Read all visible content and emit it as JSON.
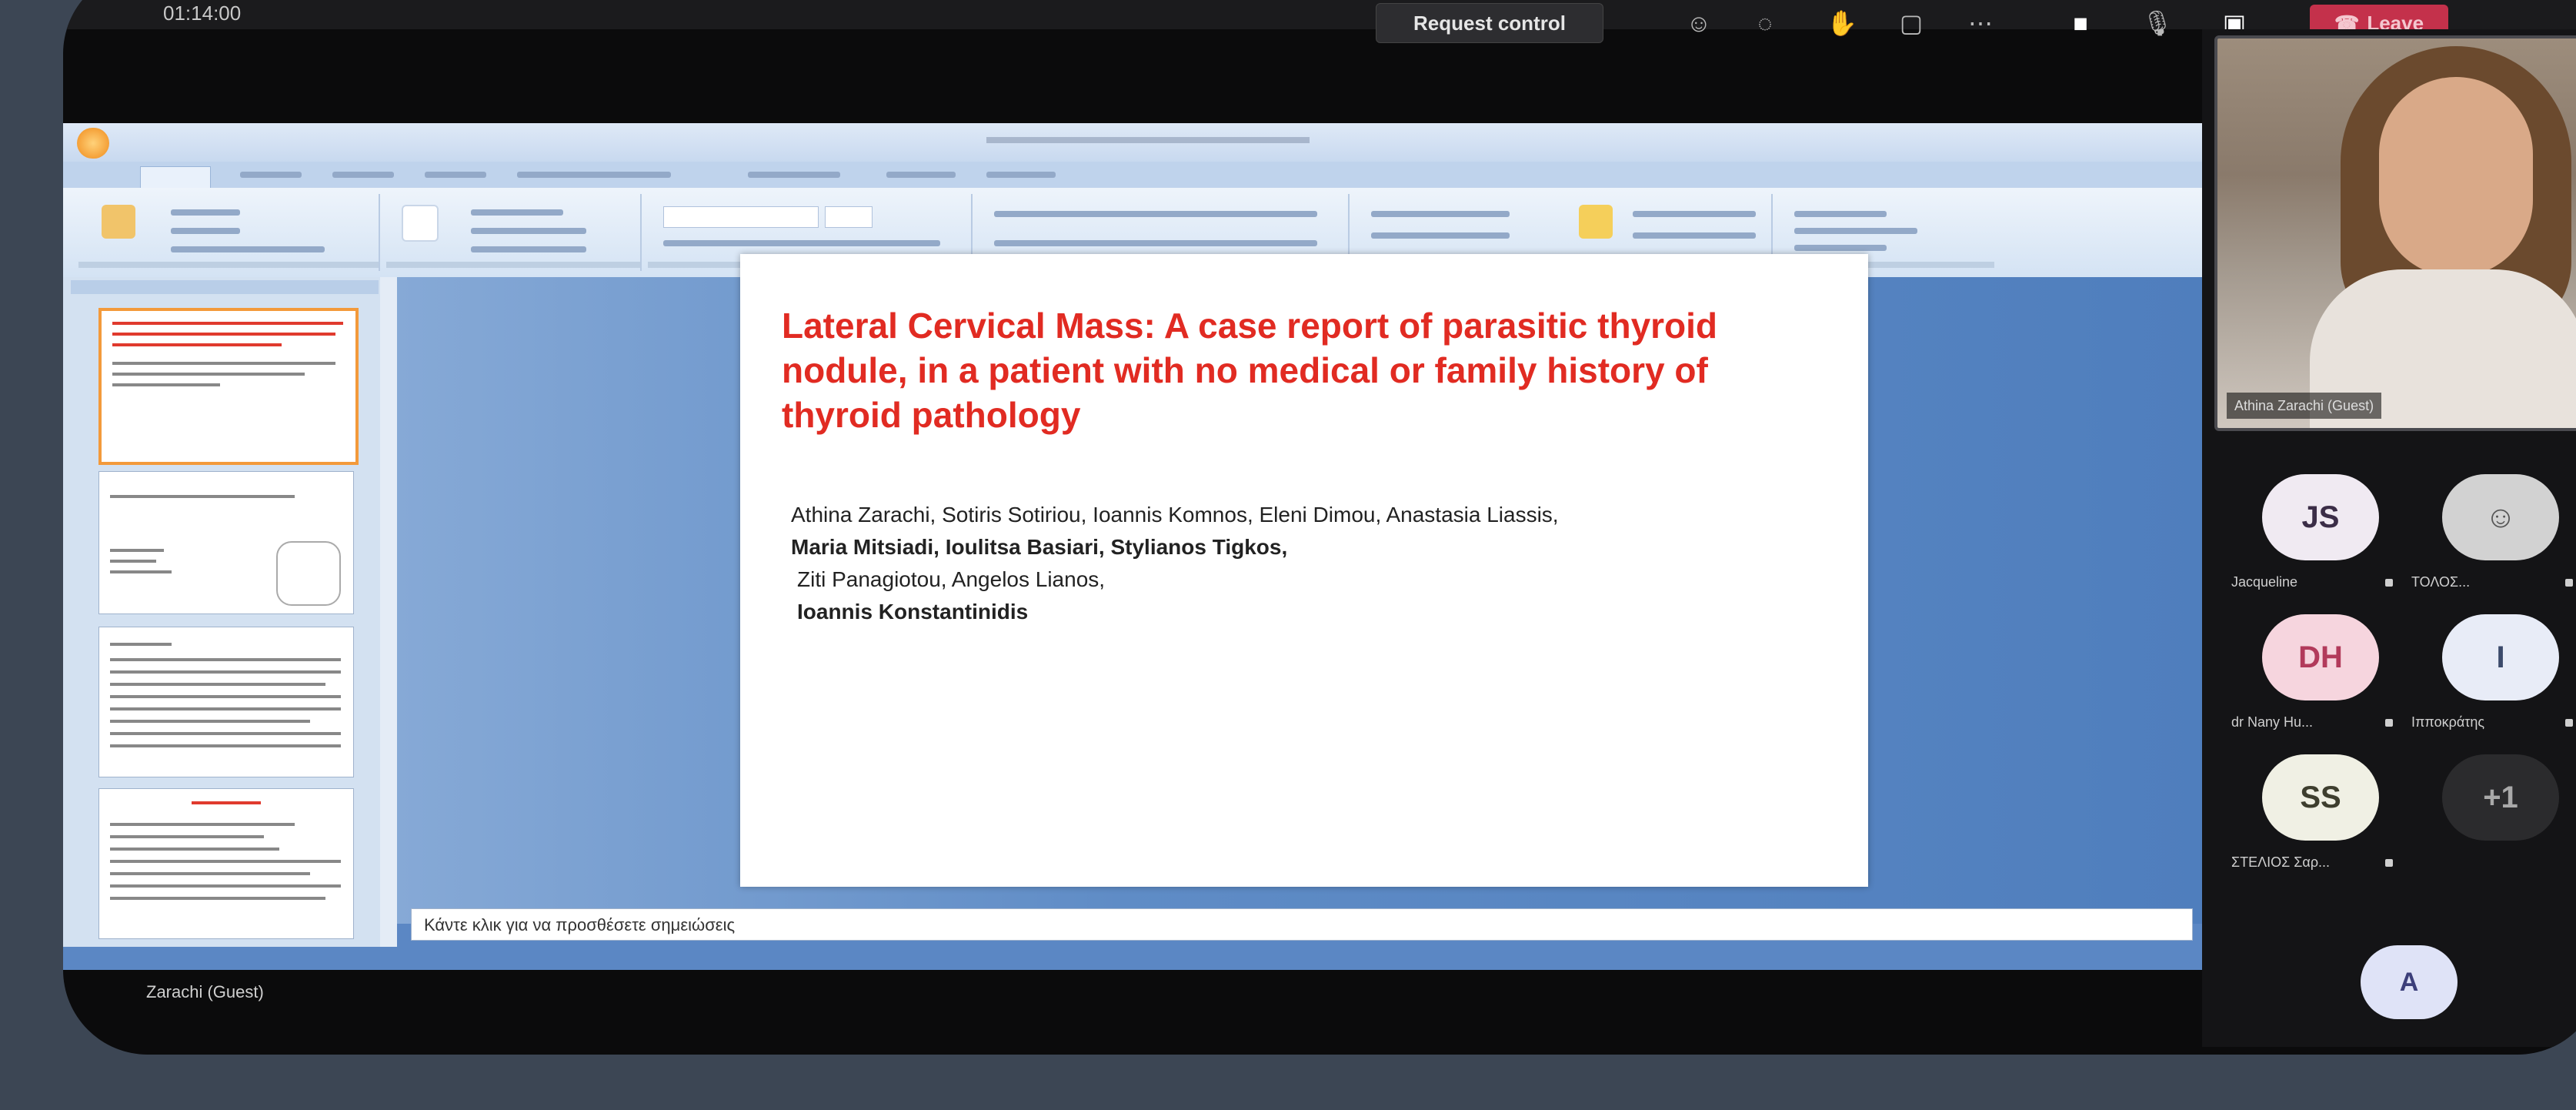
{
  "meeting": {
    "timer": "01:14:00",
    "request_control_label": "Request control",
    "leave_label": "Leave",
    "leave_color": "#c4314b",
    "toolbar_icons": [
      "people-icon",
      "chat-icon",
      "reactions-icon",
      "view-icon",
      "more-icon",
      "camera-icon",
      "mic-icon",
      "share-icon"
    ]
  },
  "presentation": {
    "slide_title": "Lateral Cervical Mass: A case report of parasitic thyroid nodule, in a patient with no medical or family history of thyroid pathology",
    "authors_line1": "Athina Zarachi, Sotiris Sotiriou, Ioannis Komnos, Eleni Dimou, Anastasia Liassis,",
    "authors_line2": "Maria Mitsiadi, Ioulitsa Basiari, Stylianos Tigkos,",
    "authors_line3": "Ziti Panagiotou, Angelos Lianos,",
    "authors_line4": "Ioannis Konstantinidis",
    "notes_text": "Κάντε κλικ για να προσθέσετε σημειώσεις"
  },
  "presenter_label": "Zarachi (Guest)",
  "participants": [
    {
      "initials": "JS",
      "name": "Jacqueline",
      "bg": "#f0eaf2",
      "fg": "#3b2d47"
    },
    {
      "initials": "",
      "name": "ΤΟΛΟΣ...",
      "bg": "#d2d2d2",
      "fg": "#555555",
      "icon": "person-icon"
    },
    {
      "initials": "DH",
      "name": "dr Nany Hu...",
      "bg": "#f6d5de",
      "fg": "#b23a5b"
    },
    {
      "initials": "I",
      "name": "Ιπποκράτης",
      "bg": "#e8ecf7",
      "fg": "#3b4a6b"
    },
    {
      "initials": "SS",
      "name": "ΣΤΕΛΙΟΣ Σαρ...",
      "bg": "#f0f0e4",
      "fg": "#3e3e2e"
    },
    {
      "initials": "+1",
      "name": "",
      "bg": "#2b2b2d",
      "fg": "#a9a9a9"
    }
  ],
  "self_avatar": {
    "initials": "A",
    "bg": "#dfe3f7",
    "fg": "#3c3f7a"
  },
  "video_name": "Athina Zarachi (Guest)"
}
